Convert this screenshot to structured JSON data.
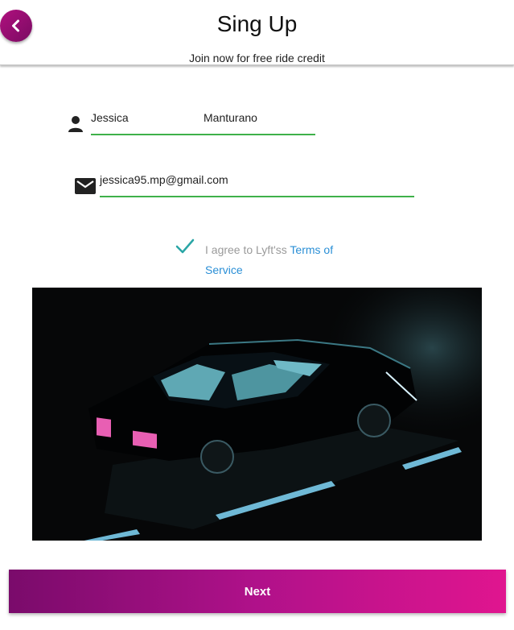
{
  "header": {
    "title": "Sing Up",
    "subtitle": "Join now for free ride credit",
    "back_icon": "chevron-left-icon"
  },
  "form": {
    "first_name": "Jessica",
    "last_name": "Manturano",
    "email": "jessica95.mp@gmail.com",
    "person_icon": "person-icon",
    "email_icon": "mail-icon"
  },
  "agreement": {
    "checked": true,
    "text": "I agree to Lyft'ss ",
    "terms_link": "Terms of Service"
  },
  "next_button": {
    "label": "Next"
  },
  "colors": {
    "accent": "#b0107e",
    "underline": "#3fb14a",
    "check": "#2aa6a6",
    "link": "#2a8fd6"
  }
}
